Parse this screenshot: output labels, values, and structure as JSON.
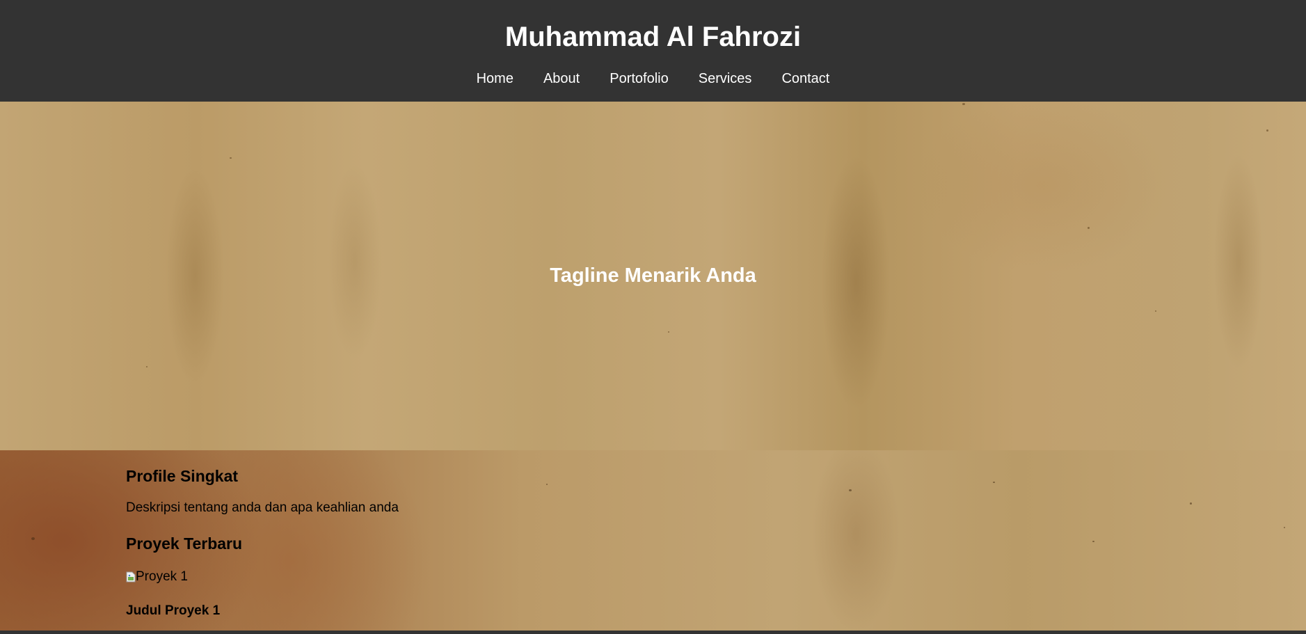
{
  "header": {
    "site_title": "Muhammad Al Fahrozi",
    "nav": [
      {
        "label": "Home"
      },
      {
        "label": "About"
      },
      {
        "label": "Portofolio"
      },
      {
        "label": "Services"
      },
      {
        "label": "Contact"
      }
    ]
  },
  "hero": {
    "tagline": "Tagline Menarik Anda"
  },
  "profile": {
    "heading": "Profile Singkat",
    "description": "Deskripsi tentang anda dan apa keahlian anda"
  },
  "projects": {
    "heading": "Proyek Terbaru",
    "items": [
      {
        "image_alt": "Proyek 1",
        "title": "Judul Proyek 1"
      }
    ]
  },
  "colors": {
    "header_bg": "#333333",
    "text_light": "#ffffff",
    "text_dark": "#000000"
  }
}
